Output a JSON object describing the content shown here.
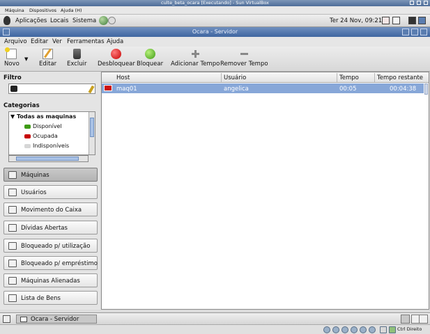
{
  "vbox": {
    "title": "culte_beta_ocara [Executando] - Sun VirtualBox",
    "menu": [
      "Máquina",
      "Dispositivos",
      "Ajuda (H)"
    ]
  },
  "panel": {
    "menus": [
      "Aplicações",
      "Locais",
      "Sistema"
    ],
    "clock": "Ter 24 Nov, 09:21"
  },
  "window": {
    "title": "Ocara - Servidor"
  },
  "menubar": [
    "Arquivo",
    "Editar",
    "Ver",
    "Ferramentas",
    "Ajuda"
  ],
  "toolbar": {
    "novo": "Novo",
    "editar": "Editar",
    "excluir": "Excluir",
    "desbloquear": "Desbloquear",
    "bloquear": "Bloquear",
    "adicionar_tempo": "Adicionar Tempo",
    "remover_tempo": "Remover Tempo"
  },
  "sidebar": {
    "filtro_label": "Filtro",
    "categorias_label": "Categorias",
    "tree": {
      "root": "Todas as maquinas",
      "items": [
        "Disponível",
        "Ocupada",
        "Indisponíveis"
      ]
    },
    "nav": [
      "Máquinas",
      "Usuários",
      "Movimento do Caixa",
      "Dívidas Abertas",
      "Bloqueado p/ utilização",
      "Bloqueado p/ empréstimo",
      "Máquinas Alienadas",
      "Lista de Bens"
    ]
  },
  "table": {
    "columns": [
      "Host",
      "Usuário",
      "Tempo",
      "Tempo restante"
    ],
    "rows": [
      {
        "host": "maq01",
        "usuario": "angelica",
        "tempo": "00:05",
        "restante": "00:04:38"
      }
    ]
  },
  "taskbar": {
    "task": "Ocara - Servidor"
  },
  "statusbar": {
    "hostkey": "Ctrl Direito"
  },
  "colors": {
    "titlebar": "#4d6d99",
    "selection": "#87a7d8",
    "desbloquear": "#c60000",
    "bloquear": "#3e9a14"
  }
}
